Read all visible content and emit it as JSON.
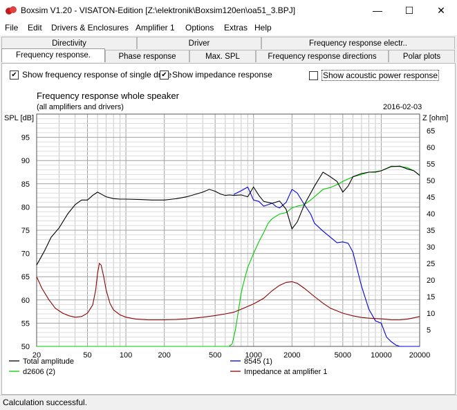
{
  "window": {
    "title": "Boxsim V1.20 - VISATON-Edition [Z:\\elektronik\\Boxsim120en\\oa51_3.BPJ]",
    "minimize": "—",
    "maximize": "☐",
    "close": "✕"
  },
  "menu": [
    "File",
    "Edit",
    "Drivers & Enclosures",
    "Amplifier 1",
    "Options",
    "Extras",
    "Help"
  ],
  "tabs_row1": [
    "Directivity",
    "Driver",
    "Frequency response electr.."
  ],
  "tabs_row2": [
    "Frequency response.",
    "Phase response",
    "Max. SPL",
    "Frequency response directions",
    "Polar plots"
  ],
  "active_tab": "Frequency response.",
  "options": {
    "single_drive": {
      "label": "Show frequency response of single drive",
      "checked": true
    },
    "impedance": {
      "label": "Show impedance response",
      "checked": true
    },
    "acoustic_power": {
      "label": "Show acoustic power response",
      "checked": false
    }
  },
  "status": "Calculation successful.",
  "colors": {
    "total": "#000000",
    "d2606": "#00cc00",
    "8545": "#0000dd",
    "impedance": "#8b0000"
  },
  "chart_data": {
    "type": "line",
    "title": "Frequency response whole speaker",
    "subtitle": "(all amplifiers and drivers)",
    "date": "2016-02-03",
    "ylabel": "SPL [dB]",
    "y2label": "Z [ohm]",
    "x_scale": "log",
    "xlim": [
      20,
      20000
    ],
    "ylim": [
      50,
      100
    ],
    "y2lim": [
      0,
      70
    ],
    "x_ticks": [
      "20",
      "50",
      "100",
      "200",
      "500",
      "1000",
      "2000",
      "5000",
      "10000",
      "20000"
    ],
    "y_ticks": [
      "50",
      "55",
      "60",
      "65",
      "70",
      "75",
      "80",
      "85",
      "90",
      "95"
    ],
    "y2_ticks": [
      "5",
      "10",
      "15",
      "20",
      "25",
      "30",
      "35",
      "40",
      "45",
      "50",
      "55",
      "60",
      "65"
    ],
    "grid": true,
    "legend": [
      "Total amplitude",
      "8545 (1)",
      "d2606 (2)",
      "Impedance at amplifier 1"
    ],
    "series": [
      {
        "name": "Total amplitude",
        "axis": "left",
        "x": [
          20,
          23,
          26,
          30,
          35,
          40,
          45,
          50,
          55,
          60,
          65,
          70,
          80,
          90,
          100,
          130,
          160,
          200,
          250,
          300,
          400,
          450,
          500,
          550,
          600,
          650,
          700,
          800,
          900,
          1000,
          1100,
          1200,
          1400,
          1600,
          1800,
          2000,
          2200,
          2500,
          3000,
          3500,
          4000,
          4500,
          5000,
          5500,
          6000,
          7000,
          8000,
          9000,
          10000,
          12000,
          14000,
          16000,
          18000,
          20000
        ],
        "y": [
          67.5,
          70.5,
          73.5,
          75.5,
          78.5,
          80.5,
          81.5,
          81.5,
          82.5,
          83.2,
          82.7,
          82.2,
          81.8,
          81.7,
          81.7,
          81.6,
          81.5,
          81.5,
          81.8,
          82.2,
          83.2,
          83.8,
          83.4,
          82.8,
          82.5,
          82.6,
          82.5,
          82.6,
          82.2,
          84.3,
          82.5,
          81.2,
          80.8,
          81.3,
          79.5,
          75.3,
          76.8,
          80.5,
          84.5,
          87.5,
          86.5,
          85.5,
          83.2,
          84.5,
          86.5,
          87.2,
          87.5,
          87.5,
          87.8,
          88.7,
          88.8,
          88.2,
          87.8,
          86.8
        ]
      },
      {
        "name": "8545 (1)",
        "axis": "left",
        "x": [
          700,
          800,
          900,
          1000,
          1100,
          1200,
          1300,
          1400,
          1500,
          1600,
          1800,
          2000,
          2200,
          2500,
          2800,
          3000,
          3500,
          4000,
          4500,
          5000,
          5500,
          6000,
          7000,
          8000,
          9000,
          10000,
          11000,
          12000,
          13000,
          14000,
          16000,
          18000,
          20000
        ],
        "y": [
          82.7,
          83.5,
          84.3,
          81.5,
          81.2,
          80.2,
          80.5,
          80.8,
          80.1,
          79.8,
          81.0,
          83.8,
          83.0,
          80.5,
          78.5,
          76.5,
          74.8,
          73.5,
          72.3,
          72.5,
          72.2,
          70.3,
          63.0,
          58.0,
          55.5,
          55.0,
          52.0,
          51.0,
          50.3,
          50.0,
          50.0,
          50.0,
          50.0
        ]
      },
      {
        "name": "d2606 (2)",
        "axis": "left",
        "x": [
          20,
          600,
          640,
          680,
          720,
          760,
          800,
          850,
          900,
          1000,
          1100,
          1200,
          1300,
          1400,
          1600,
          1800,
          2000,
          2200,
          2500,
          2800,
          3000,
          3500,
          4000,
          4500,
          5000,
          6000,
          7000,
          8000,
          9000,
          10000,
          12000,
          14000,
          16000,
          18000,
          20000
        ],
        "y": [
          50,
          50,
          50,
          50.5,
          53.5,
          57.5,
          61.5,
          64.5,
          67.0,
          70.0,
          72.5,
          74.5,
          76.5,
          77.5,
          78.5,
          78.8,
          79.8,
          80.2,
          80.5,
          81.5,
          82.2,
          83.8,
          84.2,
          84.8,
          85.5,
          86.5,
          87.0,
          87.5,
          87.6,
          87.8,
          88.8,
          88.7,
          88.5,
          87.8,
          86.8
        ]
      },
      {
        "name": "Impedance at amplifier 1",
        "axis": "right",
        "x": [
          20,
          22,
          25,
          28,
          32,
          36,
          40,
          45,
          50,
          55,
          58,
          60,
          62,
          64,
          67,
          70,
          75,
          80,
          90,
          100,
          120,
          150,
          200,
          250,
          300,
          400,
          500,
          600,
          700,
          800,
          1000,
          1200,
          1400,
          1600,
          1800,
          2000,
          2200,
          2500,
          3000,
          3500,
          4000,
          5000,
          6000,
          7000,
          8000,
          10000,
          12000,
          14000,
          16000,
          18000,
          20000
        ],
        "y": [
          21,
          17.5,
          14,
          11.5,
          10,
          9.2,
          8.8,
          9.0,
          10.0,
          12.5,
          17,
          22,
          25,
          24.5,
          21,
          17,
          13,
          11,
          9.5,
          8.8,
          8.2,
          8.0,
          8.0,
          8.1,
          8.3,
          8.8,
          9.3,
          9.8,
          10.3,
          11.2,
          12.8,
          14.5,
          16.8,
          18.4,
          19.3,
          19.5,
          19.0,
          17.5,
          15.0,
          13.0,
          11.5,
          10.0,
          9.2,
          8.7,
          8.5,
          8.3,
          8.0,
          8.0,
          8.2,
          8.6,
          9.0
        ]
      }
    ]
  }
}
